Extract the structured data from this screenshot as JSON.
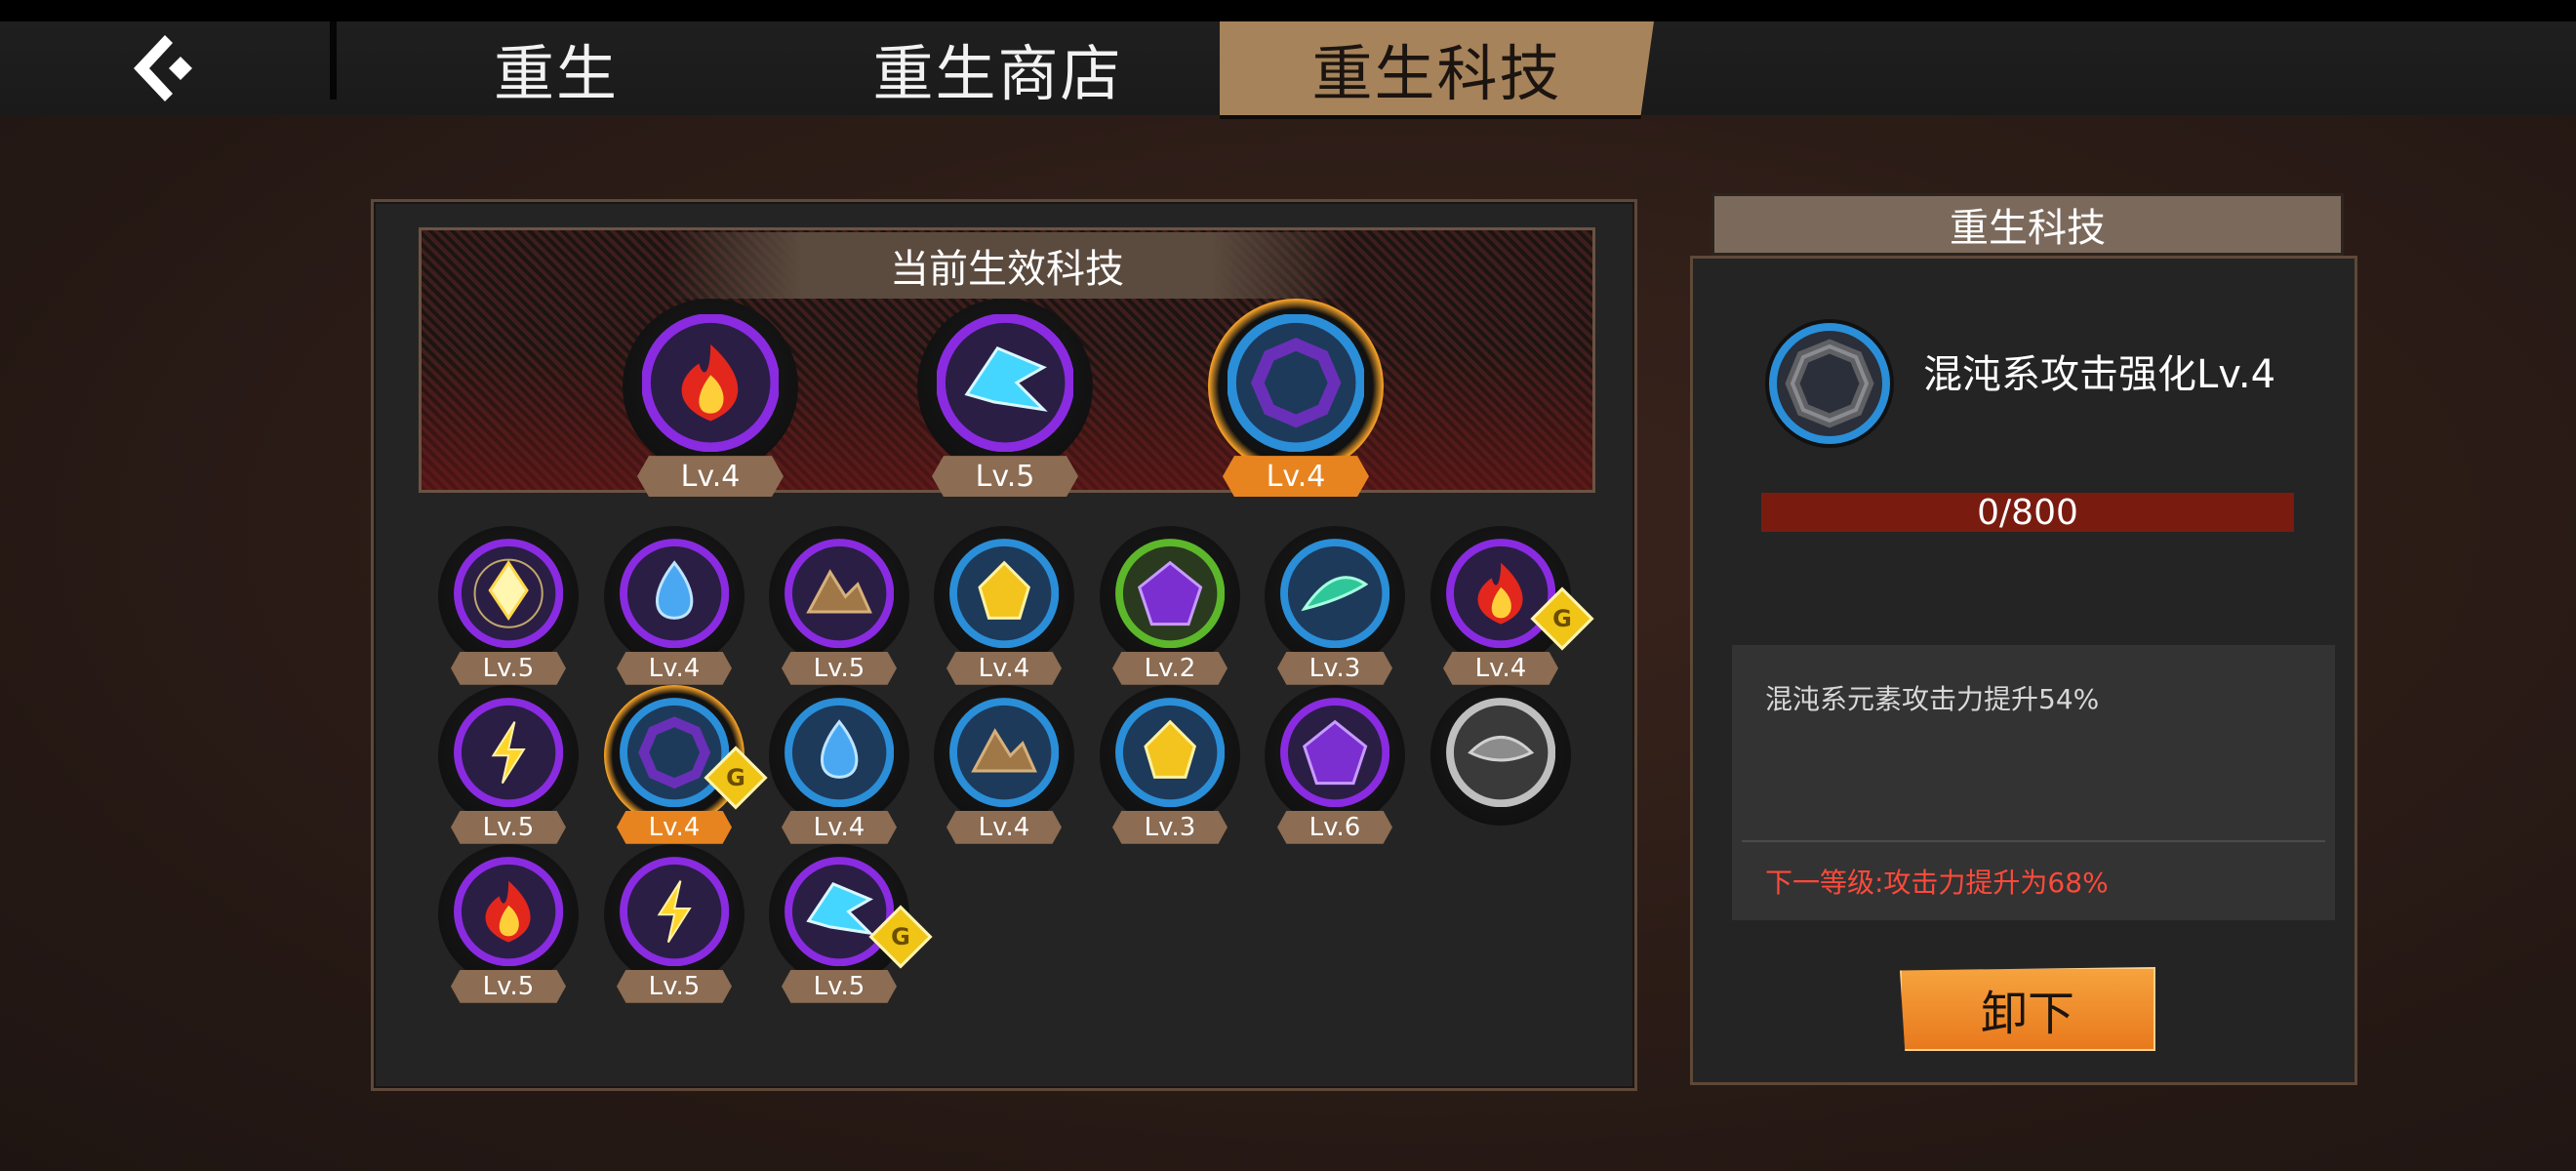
{
  "header": {
    "back_icon": "back-arrow-icon",
    "tabs": [
      {
        "label": "重生",
        "active": false
      },
      {
        "label": "重生商店",
        "active": false
      },
      {
        "label": "重生科技",
        "active": true
      }
    ]
  },
  "active_tech": {
    "title": "当前生效科技",
    "items": [
      {
        "icon": "fire-icon",
        "level": "Lv.4",
        "selected": false
      },
      {
        "icon": "ice-dragon-icon",
        "level": "Lv.5",
        "selected": false
      },
      {
        "icon": "chaos-ring-icon",
        "level": "Lv.4",
        "selected": true
      }
    ]
  },
  "tech_grid": [
    {
      "icon": "light-crystal-icon",
      "level": "Lv.5",
      "ring": "purple",
      "badge": false,
      "selected": false
    },
    {
      "icon": "water-drop-icon",
      "level": "Lv.4",
      "ring": "purple",
      "badge": false,
      "selected": false
    },
    {
      "icon": "earth-rocks-icon",
      "level": "Lv.5",
      "ring": "purple",
      "badge": false,
      "selected": false
    },
    {
      "icon": "gold-crystal-icon",
      "level": "Lv.4",
      "ring": "blue",
      "badge": false,
      "selected": false
    },
    {
      "icon": "chaos-gem-icon",
      "level": "Lv.2",
      "ring": "green",
      "badge": false,
      "selected": false
    },
    {
      "icon": "wind-leaf-icon",
      "level": "Lv.3",
      "ring": "blue",
      "badge": false,
      "selected": false
    },
    {
      "icon": "fire-icon",
      "level": "Lv.4",
      "ring": "purple",
      "badge": true,
      "selected": false
    },
    {
      "icon": "lightning-icon",
      "level": "Lv.5",
      "ring": "purple",
      "badge": false,
      "selected": false
    },
    {
      "icon": "chaos-ring-icon",
      "level": "Lv.4",
      "ring": "blue",
      "badge": true,
      "selected": true
    },
    {
      "icon": "water-drop-icon",
      "level": "Lv.4",
      "ring": "blue",
      "badge": false,
      "selected": false
    },
    {
      "icon": "earth-rocks-icon",
      "level": "Lv.4",
      "ring": "blue",
      "badge": false,
      "selected": false
    },
    {
      "icon": "gold-crystal-icon",
      "level": "Lv.3",
      "ring": "blue",
      "badge": false,
      "selected": false
    },
    {
      "icon": "chaos-gem-icon",
      "level": "Lv.6",
      "ring": "purple",
      "badge": false,
      "selected": false
    },
    {
      "icon": "locked-wind-icon",
      "level": "",
      "ring": "grey",
      "badge": false,
      "selected": false
    },
    {
      "icon": "fire-icon",
      "level": "Lv.5",
      "ring": "purple",
      "badge": false,
      "selected": false
    },
    {
      "icon": "lightning-icon",
      "level": "Lv.5",
      "ring": "purple",
      "badge": false,
      "selected": false
    },
    {
      "icon": "ice-dragon-icon",
      "level": "Lv.5",
      "ring": "purple",
      "badge": true,
      "selected": false
    }
  ],
  "badge_letter": "G",
  "detail": {
    "panel_title": "重生科技",
    "name": "混沌系攻击强化Lv.4",
    "progress_text": "0/800",
    "progress_fraction": 0,
    "description": "混沌系元素攻击力提升54%",
    "next_level": "下一等级:攻击力提升为68%",
    "unequip_label": "卸下"
  },
  "colors": {
    "accent_orange": "#e8841f",
    "tab_active": "#a6835a",
    "ring_purple": "#8a2be2",
    "ring_blue": "#2a8fd8",
    "ring_green": "#5cb82a",
    "progress_bg": "#7a1b10",
    "next_level_text": "#ff4a3a"
  }
}
